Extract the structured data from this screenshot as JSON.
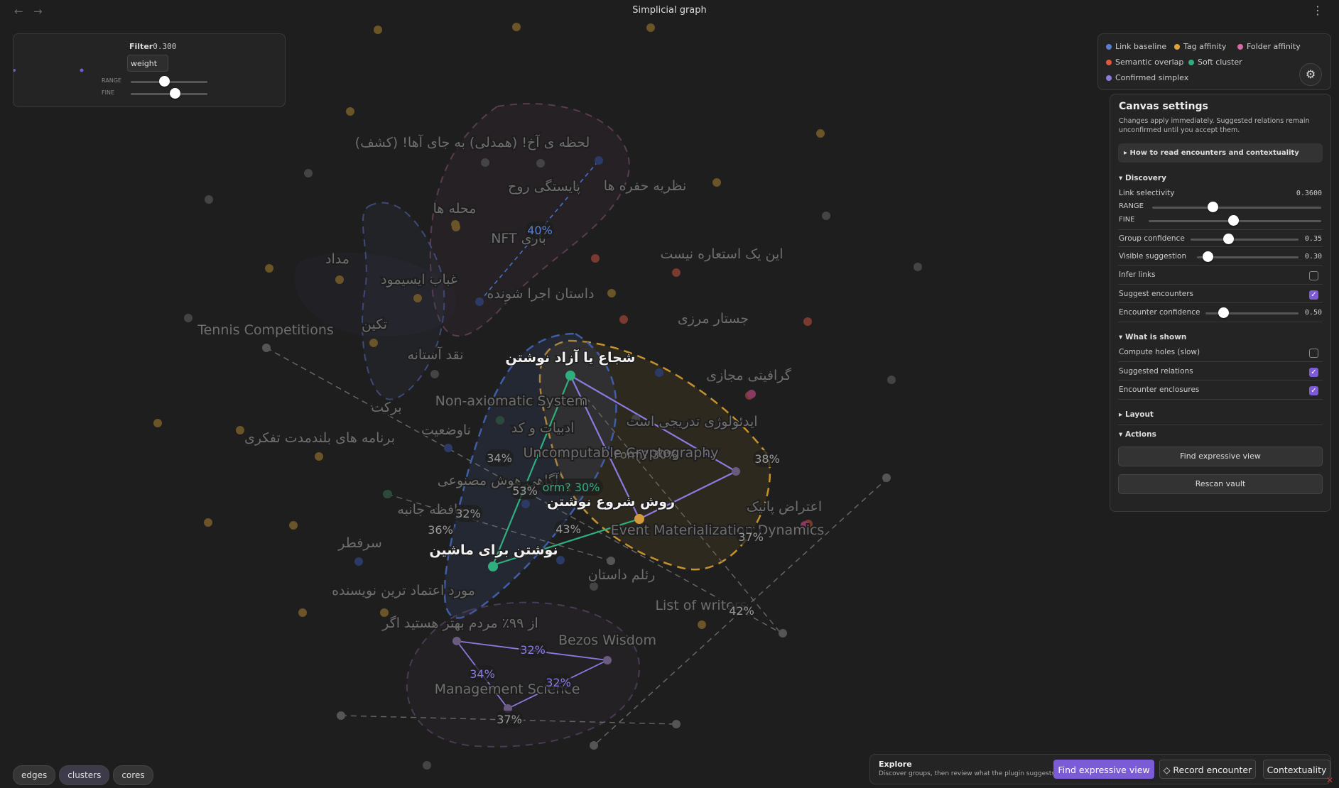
{
  "window": {
    "title": "Simplicial graph",
    "back_icon": "arrow-left-icon",
    "forward_icon": "arrow-right-icon",
    "menu_icon": "kebab-menu-icon"
  },
  "filter": {
    "label": "Filter",
    "value": "0.300",
    "field": "weight",
    "range_label": "RANGE",
    "fine_label": "FINE"
  },
  "legend": [
    {
      "label": "Link baseline",
      "color": "#5b7fd0"
    },
    {
      "label": "Tag affinity",
      "color": "#e0a23a"
    },
    {
      "label": "Folder affinity",
      "color": "#d86aa8"
    },
    {
      "label": "Semantic overlap",
      "color": "#e0573f"
    },
    {
      "label": "Soft cluster",
      "color": "#2fae7e"
    },
    {
      "label": "Confirmed simplex",
      "color": "#8a7be0"
    }
  ],
  "settings": {
    "title": "Canvas settings",
    "description": "Changes apply immediately. Suggested relations remain unconfirmed until you accept them.",
    "howto": "How to read encounters and contextuality",
    "discovery": {
      "header": "Discovery",
      "link_selectivity_label": "Link selectivity",
      "link_selectivity_value": "0.3600",
      "range_label": "RANGE",
      "fine_label": "FINE",
      "group_confidence_label": "Group confidence",
      "group_confidence_value": "0.35",
      "visible_suggestion_label": "Visible suggestion",
      "visible_suggestion_value": "0.30",
      "infer_links_label": "Infer links",
      "infer_links": false,
      "suggest_encounters_label": "Suggest encounters",
      "suggest_encounters": true,
      "encounter_confidence_label": "Encounter confidence",
      "encounter_confidence_value": "0.50"
    },
    "shown": {
      "header": "What is shown",
      "compute_holes_label": "Compute holes (slow)",
      "compute_holes": false,
      "suggested_relations_label": "Suggested relations",
      "suggested_relations": true,
      "encounter_enclosures_label": "Encounter enclosures",
      "encounter_enclosures": true
    },
    "layout_header": "Layout",
    "actions_header": "Actions",
    "find_expressive": "Find expressive view",
    "rescan": "Rescan vault"
  },
  "pills": [
    "edges",
    "clusters",
    "cores"
  ],
  "explore": {
    "title": "Explore",
    "subtitle": "Discover groups, then review what the plugin suggests",
    "find_expressive": "Find expressive view",
    "record_encounter": "◇ Record encounter",
    "contextuality": "Contextuality"
  },
  "graph": {
    "labels": [
      {
        "text": "لحظه ی آخ! (همدلی) به جای آها! (کشف)",
        "emph": false
      },
      {
        "text": "پایستگی روح",
        "emph": false
      },
      {
        "text": "نظریه حفره ها",
        "emph": false
      },
      {
        "text": "محله ها",
        "emph": false
      },
      {
        "text": "NFT بازی",
        "emph": false
      },
      {
        "text": "مداد",
        "emph": false
      },
      {
        "text": "این یک استعاره نیست",
        "emph": false
      },
      {
        "text": "غباب ایسیمود",
        "emph": false
      },
      {
        "text": "داستان اجرا شونده",
        "emph": false
      },
      {
        "text": "جستار مرزی",
        "emph": false
      },
      {
        "text": "Tennis Competitions",
        "emph": false
      },
      {
        "text": "تکین",
        "emph": false
      },
      {
        "text": "نقد آستانه",
        "emph": false
      },
      {
        "text": "شجاع یا آزاد نوشتن",
        "emph": true
      },
      {
        "text": "گرافیتی مجازی",
        "emph": false
      },
      {
        "text": "Non-axiomatic System",
        "emph": false
      },
      {
        "text": "برکت",
        "emph": false
      },
      {
        "text": "ایدئولوژی تدریجی است",
        "emph": false
      },
      {
        "text": "ادبیات و کد",
        "emph": false
      },
      {
        "text": "ناوضعیت",
        "emph": false
      },
      {
        "text": "برنامه های بلندمدت تفکری",
        "emph": false
      },
      {
        "text": "Uncomputable Cryptography",
        "emph": false
      },
      {
        "text": "آگاهی هوش مصنوعی",
        "emph": false
      },
      {
        "text": "روش شروع نوشتن",
        "emph": true
      },
      {
        "text": "اعتراض پانیک",
        "emph": false
      },
      {
        "text": "حافظه جانبه",
        "emph": false
      },
      {
        "text": "Event Materialization Dynamics",
        "emph": false
      },
      {
        "text": "سرفطر",
        "emph": false
      },
      {
        "text": "نوشتن برای ماشین",
        "emph": true
      },
      {
        "text": "رئلم داستان",
        "emph": false
      },
      {
        "text": "مورد اعتماد ترین نویسنده",
        "emph": false
      },
      {
        "text": "List of writers",
        "emph": false
      },
      {
        "text": "از ۹۹٪ مردم بهتر هستید اگر",
        "emph": false
      },
      {
        "text": "Bezos Wisdom",
        "emph": false
      },
      {
        "text": "Management Science",
        "emph": false
      }
    ],
    "edge_labels": [
      {
        "text": "40%",
        "color": "blue"
      },
      {
        "text": "34%",
        "color": "plain"
      },
      {
        "text": "orm? 30%",
        "color": "green"
      },
      {
        "text": "38%",
        "color": "plain"
      },
      {
        "text": "53%",
        "color": "plain"
      },
      {
        "text": "Form? 30%",
        "color": "faint"
      },
      {
        "text": "32%",
        "color": "plain"
      },
      {
        "text": "36%",
        "color": "plain"
      },
      {
        "text": "43%",
        "color": "plain"
      },
      {
        "text": "37%",
        "color": "plain"
      },
      {
        "text": "42%",
        "color": "plain"
      },
      {
        "text": "32%",
        "color": "purple"
      },
      {
        "text": "34%",
        "color": "purple"
      },
      {
        "text": "32%",
        "color": "purple"
      },
      {
        "text": "37%",
        "color": "plain"
      }
    ]
  }
}
